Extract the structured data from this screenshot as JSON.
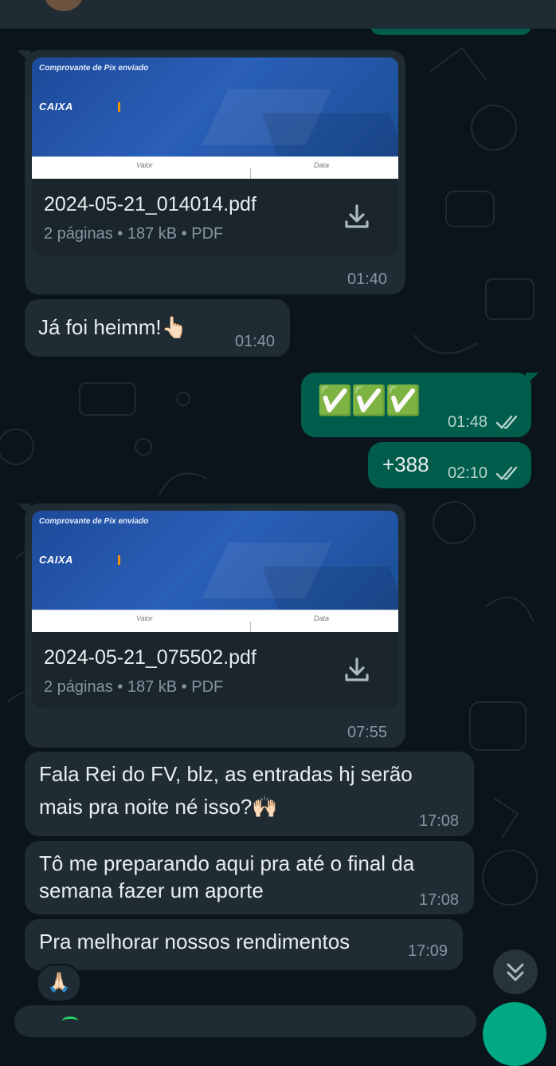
{
  "colors": {
    "background": "#0b141a",
    "incoming_bubble": "#202c33",
    "outgoing_bubble": "#005c4b",
    "accent": "#00a884",
    "read_ticks": "#b8d4cd"
  },
  "documents": [
    {
      "preview_title": "Comprovante de Pix enviado",
      "preview_brand": "CAIXA",
      "preview_col_left": "Valor",
      "preview_col_right": "Data",
      "filename": "2024-05-21_014014.pdf",
      "meta": "2 páginas • 187 kB • PDF",
      "time": "01:40",
      "icon": "download-icon"
    },
    {
      "preview_title": "Comprovante de Pix enviado",
      "preview_brand": "CAIXA",
      "preview_col_left": "Valor",
      "preview_col_right": "Data",
      "filename": "2024-05-21_075502.pdf",
      "meta": "2 páginas • 187 kB • PDF",
      "time": "07:55",
      "icon": "download-icon"
    }
  ],
  "messages": [
    {
      "direction": "incoming",
      "text": "Já foi heimm!👆🏻",
      "time": "01:40"
    },
    {
      "direction": "outgoing",
      "text": "✅✅✅",
      "time": "01:48",
      "status": "read"
    },
    {
      "direction": "outgoing",
      "text": "+388",
      "time": "02:10",
      "status": "read"
    },
    {
      "direction": "incoming",
      "line1": "Fala Rei do FV, blz, as entradas hj serão",
      "line2": "mais pra noite né isso?🙌🏻",
      "time": "17:08"
    },
    {
      "direction": "incoming",
      "line1": "Tô me preparando aqui pra até o final da",
      "line2": "semana fazer um aporte",
      "time": "17:08"
    },
    {
      "direction": "incoming",
      "text": "Pra melhorar nossos rendimentos",
      "time": "17:09"
    }
  ],
  "reaction": {
    "emoji": "🙏🏻"
  },
  "controls": {
    "scroll_down_icon": "double-chevron-down-icon",
    "mic_icon": "mic-icon",
    "emoji_icon": "emoji-icon"
  }
}
